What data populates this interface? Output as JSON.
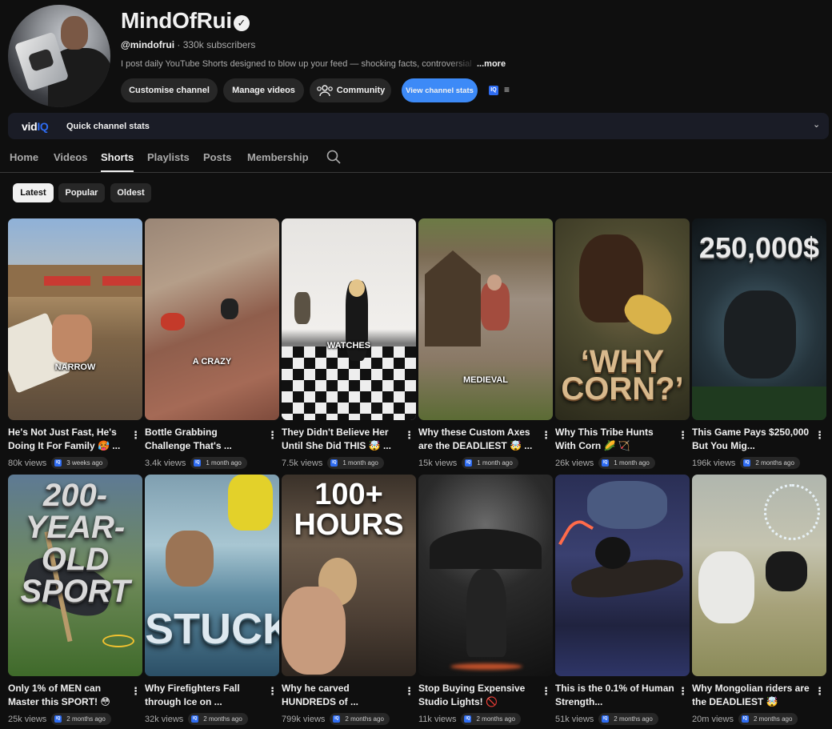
{
  "channel": {
    "name": "MindOfRui",
    "handle": "@mindofrui",
    "subscribers": "330k subscribers",
    "separator": "·",
    "description": "I post daily YouTube Shorts designed to blow up your feed — shocking facts, controversial",
    "more_label": "...more"
  },
  "header_buttons": {
    "customise": "Customise channel",
    "manage": "Manage videos",
    "community": "Community",
    "view_stats": "View channel stats",
    "iq": "IQ",
    "menu": "≡"
  },
  "vidiq": {
    "logo_vid": "vid",
    "logo_iq": "IQ",
    "label": "Quick channel stats",
    "chevron": "⌄"
  },
  "tabs": [
    "Home",
    "Videos",
    "Shorts",
    "Playlists",
    "Posts",
    "Membership"
  ],
  "active_tab": "Shorts",
  "chips": [
    "Latest",
    "Popular",
    "Oldest"
  ],
  "active_chip": "Latest",
  "iq_small": "IQ",
  "kebab": "⋮",
  "shorts": [
    {
      "title": "He's Not Just Fast, He's Doing It For Family 🥵 ...",
      "views": "80k views",
      "age": "3 weeks ago",
      "overlay": "NARROW"
    },
    {
      "title": "Bottle Grabbing Challenge That's ...",
      "views": "3.4k views",
      "age": "1 month ago",
      "overlay": "A CRAZY"
    },
    {
      "title": "They Didn't Believe Her Until She Did THIS 🤯 ...",
      "views": "7.5k views",
      "age": "1 month ago",
      "overlay": "WATCHES"
    },
    {
      "title": "Why these Custom Axes are the DEADLIEST 🤯 ...",
      "views": "15k views",
      "age": "1 month ago",
      "overlay": "MEDIEVAL"
    },
    {
      "title": "Why This Tribe Hunts With Corn 🌽 🏹",
      "views": "26k views",
      "age": "1 month ago",
      "overlay": "‘WHY CORN?’"
    },
    {
      "title": "This Game Pays $250,000 But You Mig...",
      "views": "196k views",
      "age": "2 months ago",
      "overlay": "250,000$"
    },
    {
      "title": "Only 1% of MEN can Master this SPORT! 😳",
      "views": "25k views",
      "age": "2 months ago",
      "overlay": "200-YEAR-OLD SPORT"
    },
    {
      "title": "Why Firefighters Fall through Ice on ...",
      "views": "32k views",
      "age": "2 months ago",
      "overlay": "STUCK"
    },
    {
      "title": "Why he carved HUNDREDS of ...",
      "views": "799k views",
      "age": "2 months ago",
      "overlay": "100+ HOURS"
    },
    {
      "title": "Stop Buying Expensive Studio Lights! 🚫",
      "views": "11k views",
      "age": "2 months ago",
      "overlay": ""
    },
    {
      "title": "This is the 0.1% of Human Strength...",
      "views": "51k views",
      "age": "2 months ago",
      "overlay": ""
    },
    {
      "title": "Why Mongolian riders are the DEADLIEST 🤯",
      "views": "20m views",
      "age": "2 months ago",
      "overlay": ""
    }
  ]
}
